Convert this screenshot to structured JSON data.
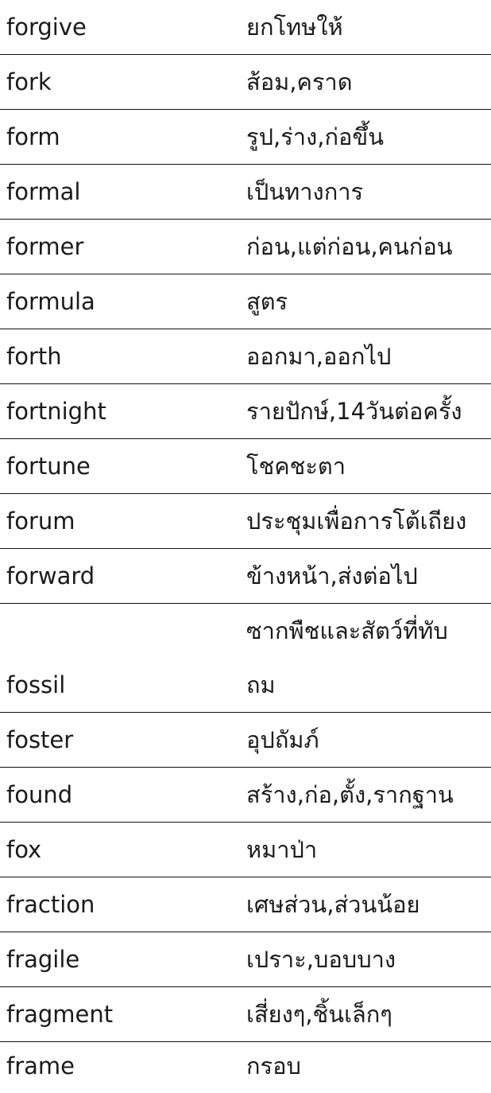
{
  "rows": [
    {
      "word": "forgive",
      "thai": "ยกโทษให้"
    },
    {
      "word": "fork",
      "thai": "ส้อม,คราด"
    },
    {
      "word": "form",
      "thai": "รูป,ร่าง,ก่อขึ้น"
    },
    {
      "word": "formal",
      "thai": "เป็นทางการ"
    },
    {
      "word": "former",
      "thai": "ก่อน,แต่ก่อน,คนก่อน"
    },
    {
      "word": "formula",
      "thai": "สูตร"
    },
    {
      "word": "forth",
      "thai": "ออกมา,ออกไป"
    },
    {
      "word": "fortnight",
      "thai": "รายปักษ์,14วันต่อครั้ง"
    },
    {
      "word": "fortune",
      "thai": "โชคชะตา"
    },
    {
      "word": "forum",
      "thai": "ประชุมเพื่อการโต้เถียง"
    },
    {
      "word": "forward",
      "thai": "ข้างหน้า,ส่งต่อไป"
    },
    {
      "word": "fossil",
      "thai_line1": "ซากพืชและสัตว์ที่ทับ",
      "thai_line2": "ถม"
    },
    {
      "word": "foster",
      "thai": "อุปถัมภ์"
    },
    {
      "word": "found",
      "thai": "สร้าง,ก่อ,ตั้ง,รากฐาน"
    },
    {
      "word": "fox",
      "thai": "หมาป่า"
    },
    {
      "word": "fraction",
      "thai": "เศษส่วน,ส่วนน้อย"
    },
    {
      "word": "fragile",
      "thai": "เปราะ,บอบบาง"
    },
    {
      "word": "fragment",
      "thai": "เสี่ยงๆ,ชิ้นเล็กๆ"
    },
    {
      "word": "frame",
      "thai": "กรอบ"
    }
  ]
}
